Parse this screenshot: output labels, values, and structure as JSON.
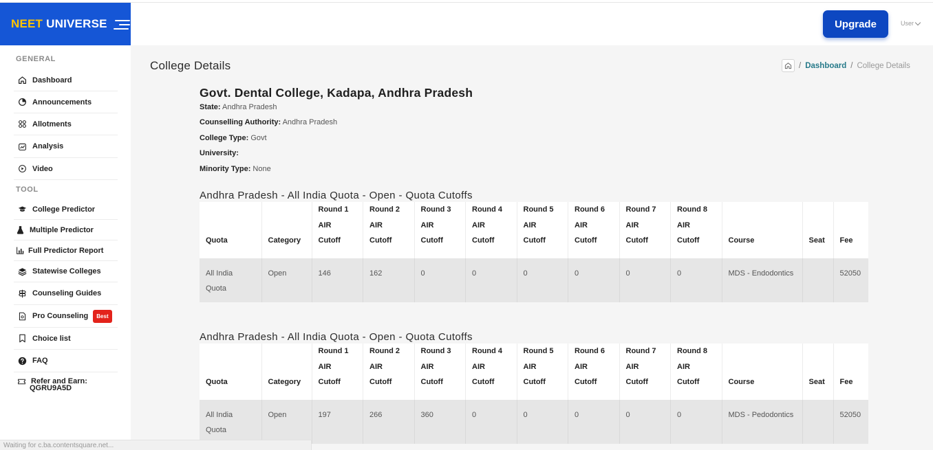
{
  "brand": {
    "word1": "NEET",
    "word2": "UNIVERSE"
  },
  "header": {
    "upgrade_label": "Upgrade",
    "user_label": "User"
  },
  "sidebar": {
    "general_label": "GENERAL",
    "tool_label": "TOOL",
    "general_items": [
      {
        "label": "Dashboard",
        "icon": "home-icon"
      },
      {
        "label": "Announcements",
        "icon": "pie-chart-icon"
      },
      {
        "label": "Allotments",
        "icon": "grid-icon"
      },
      {
        "label": "Analysis",
        "icon": "chart-icon"
      },
      {
        "label": "Video",
        "icon": "play-icon"
      }
    ],
    "tool_items": [
      {
        "label": "College Predictor",
        "icon": "graduation-cap-icon"
      },
      {
        "label": "Multiple Predictor",
        "icon": "flask-icon"
      },
      {
        "label": "Full Predictor Report",
        "icon": "bar-chart-icon"
      },
      {
        "label": "Statewise Colleges",
        "icon": "layers-icon"
      },
      {
        "label": "Counseling Guides",
        "icon": "signpost-icon"
      },
      {
        "label": "Pro Counseling",
        "icon": "document-icon",
        "badge": "Best"
      },
      {
        "label": "Choice list",
        "icon": "bookmark-icon"
      },
      {
        "label": "FAQ",
        "icon": "question-icon"
      }
    ],
    "refer": {
      "line1": "Refer and Earn:",
      "line2": "QGRU9A5D",
      "icon": "ticket-icon"
    }
  },
  "page": {
    "title": "College Details"
  },
  "breadcrumb": {
    "link": "Dashboard",
    "current": "College Details"
  },
  "college": {
    "name": "Govt. Dental College, Kadapa, Andhra Pradesh",
    "state_label": "State:",
    "state": "Andhra Pradesh",
    "authority_label": "Counselling Authority:",
    "authority": "Andhra Pradesh",
    "type_label": "College Type:",
    "type": "Govt",
    "university_label": "University:",
    "university": "",
    "minority_label": "Minority Type:",
    "minority": "None"
  },
  "tables": [
    {
      "title": "Andhra Pradesh - All India Quota - Open - Quota Cutoffs",
      "row": {
        "quota": "All India Quota",
        "category": "Open",
        "rounds": [
          "146",
          "162",
          "0",
          "0",
          "0",
          "0",
          "0",
          "0"
        ],
        "course": "MDS - Endodontics",
        "seat": "",
        "fee": "52050"
      }
    },
    {
      "title": "Andhra Pradesh - All India Quota - Open - Quota Cutoffs",
      "row": {
        "quota": "All India Quota",
        "category": "Open",
        "rounds": [
          "197",
          "266",
          "360",
          "0",
          "0",
          "0",
          "0",
          "0"
        ],
        "course": "MDS - Pedodontics",
        "seat": "",
        "fee": "52050"
      }
    }
  ],
  "table_headers": {
    "quota": "Quota",
    "category": "Category",
    "rounds": [
      [
        "Round 1",
        "AIR",
        "Cutoff"
      ],
      [
        "Round 2",
        "AIR",
        "Cutoff"
      ],
      [
        "Round 3",
        "AIR",
        "Cutoff"
      ],
      [
        "Round 4",
        "AIR",
        "Cutoff"
      ],
      [
        "Round 5",
        "AIR",
        "Cutoff"
      ],
      [
        "Round 6",
        "AIR",
        "Cutoff"
      ],
      [
        "Round 7",
        "AIR",
        "Cutoff"
      ],
      [
        "Round 8",
        "AIR",
        "Cutoff"
      ]
    ],
    "course": "Course",
    "seat": "Seat",
    "fee": "Fee"
  },
  "status_bar": "Waiting for c.ba.contentsquare.net...",
  "colors": {
    "brand_blue": "#1556d6",
    "brand_yellow": "#ffc400",
    "upgrade_blue": "#0d47c1",
    "badge_red": "#e3231b",
    "link_teal": "#277a8a"
  }
}
